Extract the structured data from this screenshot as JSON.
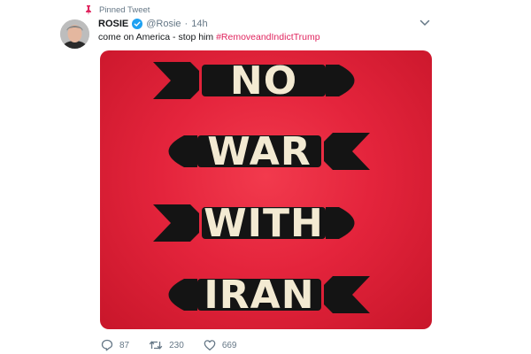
{
  "pinned_label": "Pinned Tweet",
  "user": {
    "display_name": "ROSIE",
    "handle": "@Rosie",
    "separator": "·",
    "time": "14h"
  },
  "tweet": {
    "text": "come on America - stop him ",
    "hashtag": "#RemoveandIndictTrump"
  },
  "media": {
    "words": [
      "NO",
      "WAR",
      "WITH",
      "IRAN"
    ],
    "background_color": "#e4243c",
    "missile_color": "#141414",
    "text_color": "#f3ead2"
  },
  "actions": {
    "replies": "87",
    "retweets": "230",
    "likes": "669"
  },
  "colors": {
    "hashtag": "#e0245e",
    "secondary_text": "#657786",
    "verified": "#1da1f2",
    "pin": "#e0245e"
  },
  "icons": [
    "pin-icon",
    "verified-icon",
    "chevron-down-icon",
    "reply-icon",
    "retweet-icon",
    "like-icon"
  ]
}
